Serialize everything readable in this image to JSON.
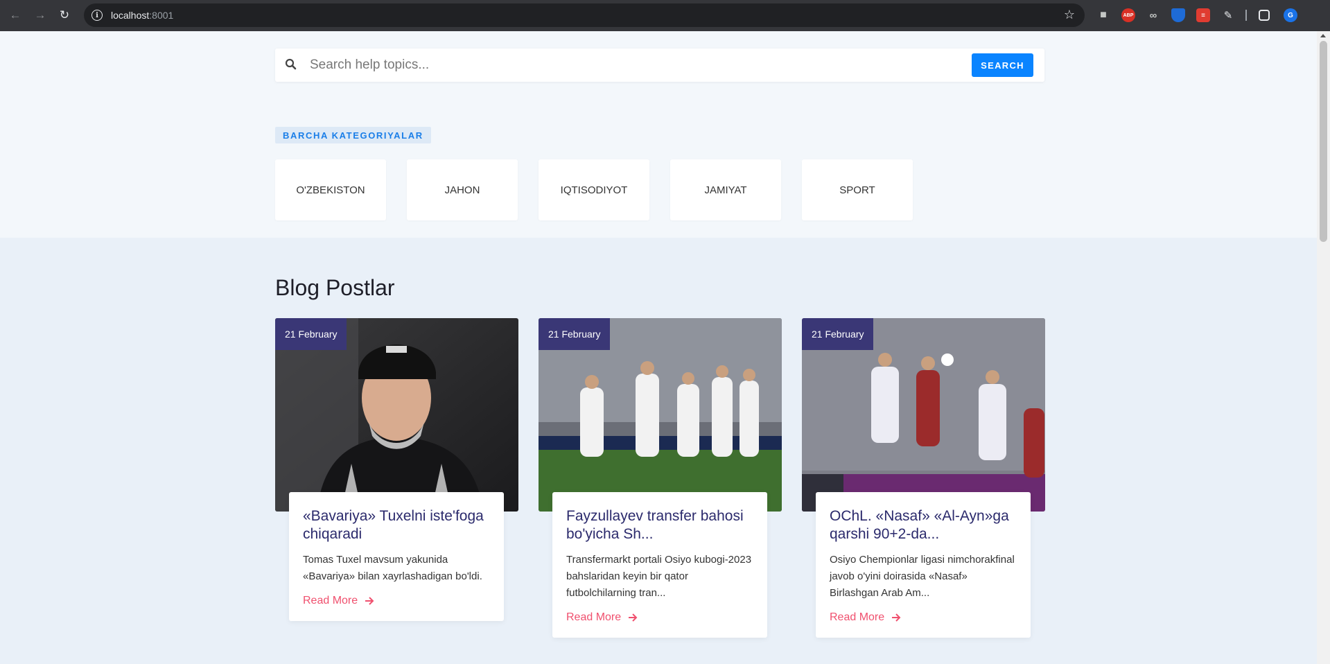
{
  "browser": {
    "url_host": "localhost",
    "url_port": ":8001"
  },
  "search": {
    "placeholder": "Search help topics...",
    "button_label": "SEARCH"
  },
  "categories": {
    "tag": "BARCHA KATEGORIYALAR",
    "items": [
      "O'ZBEKISTON",
      "JAHON",
      "IQTISODIYOT",
      "JAMIYAT",
      "SPORT"
    ]
  },
  "blog": {
    "title": "Blog Postlar",
    "posts": [
      {
        "date": "21 February",
        "title": "«Bavariya» Tuxelni iste'foga chiqaradi",
        "excerpt": "Tomas Tuxel mavsum yakunida «Bavariya» bilan xayrlashadigan bo'ldi.",
        "read_more": "Read More"
      },
      {
        "date": "21 February",
        "title": "Fayzullayev transfer bahosi bo'yicha Sh...",
        "excerpt": "Transfermarkt portali Osiyo kubogi-2023 bahslaridan keyin bir qator futbolchilarning tran...",
        "read_more": "Read More"
      },
      {
        "date": "21 February",
        "title": "OChL. «Nasaf» «Al-Ayn»ga qarshi 90+2-da...",
        "excerpt": "Osiyo Chempionlar ligasi nimchorakfinal javob o'yini doirasida «Nasaf» Birlashgan Arab Am...",
        "read_more": "Read More"
      }
    ]
  },
  "colors": {
    "accent": "#0a84ff",
    "badge": "#3a3776",
    "title": "#2b2a6c",
    "read_more": "#f0506e"
  }
}
